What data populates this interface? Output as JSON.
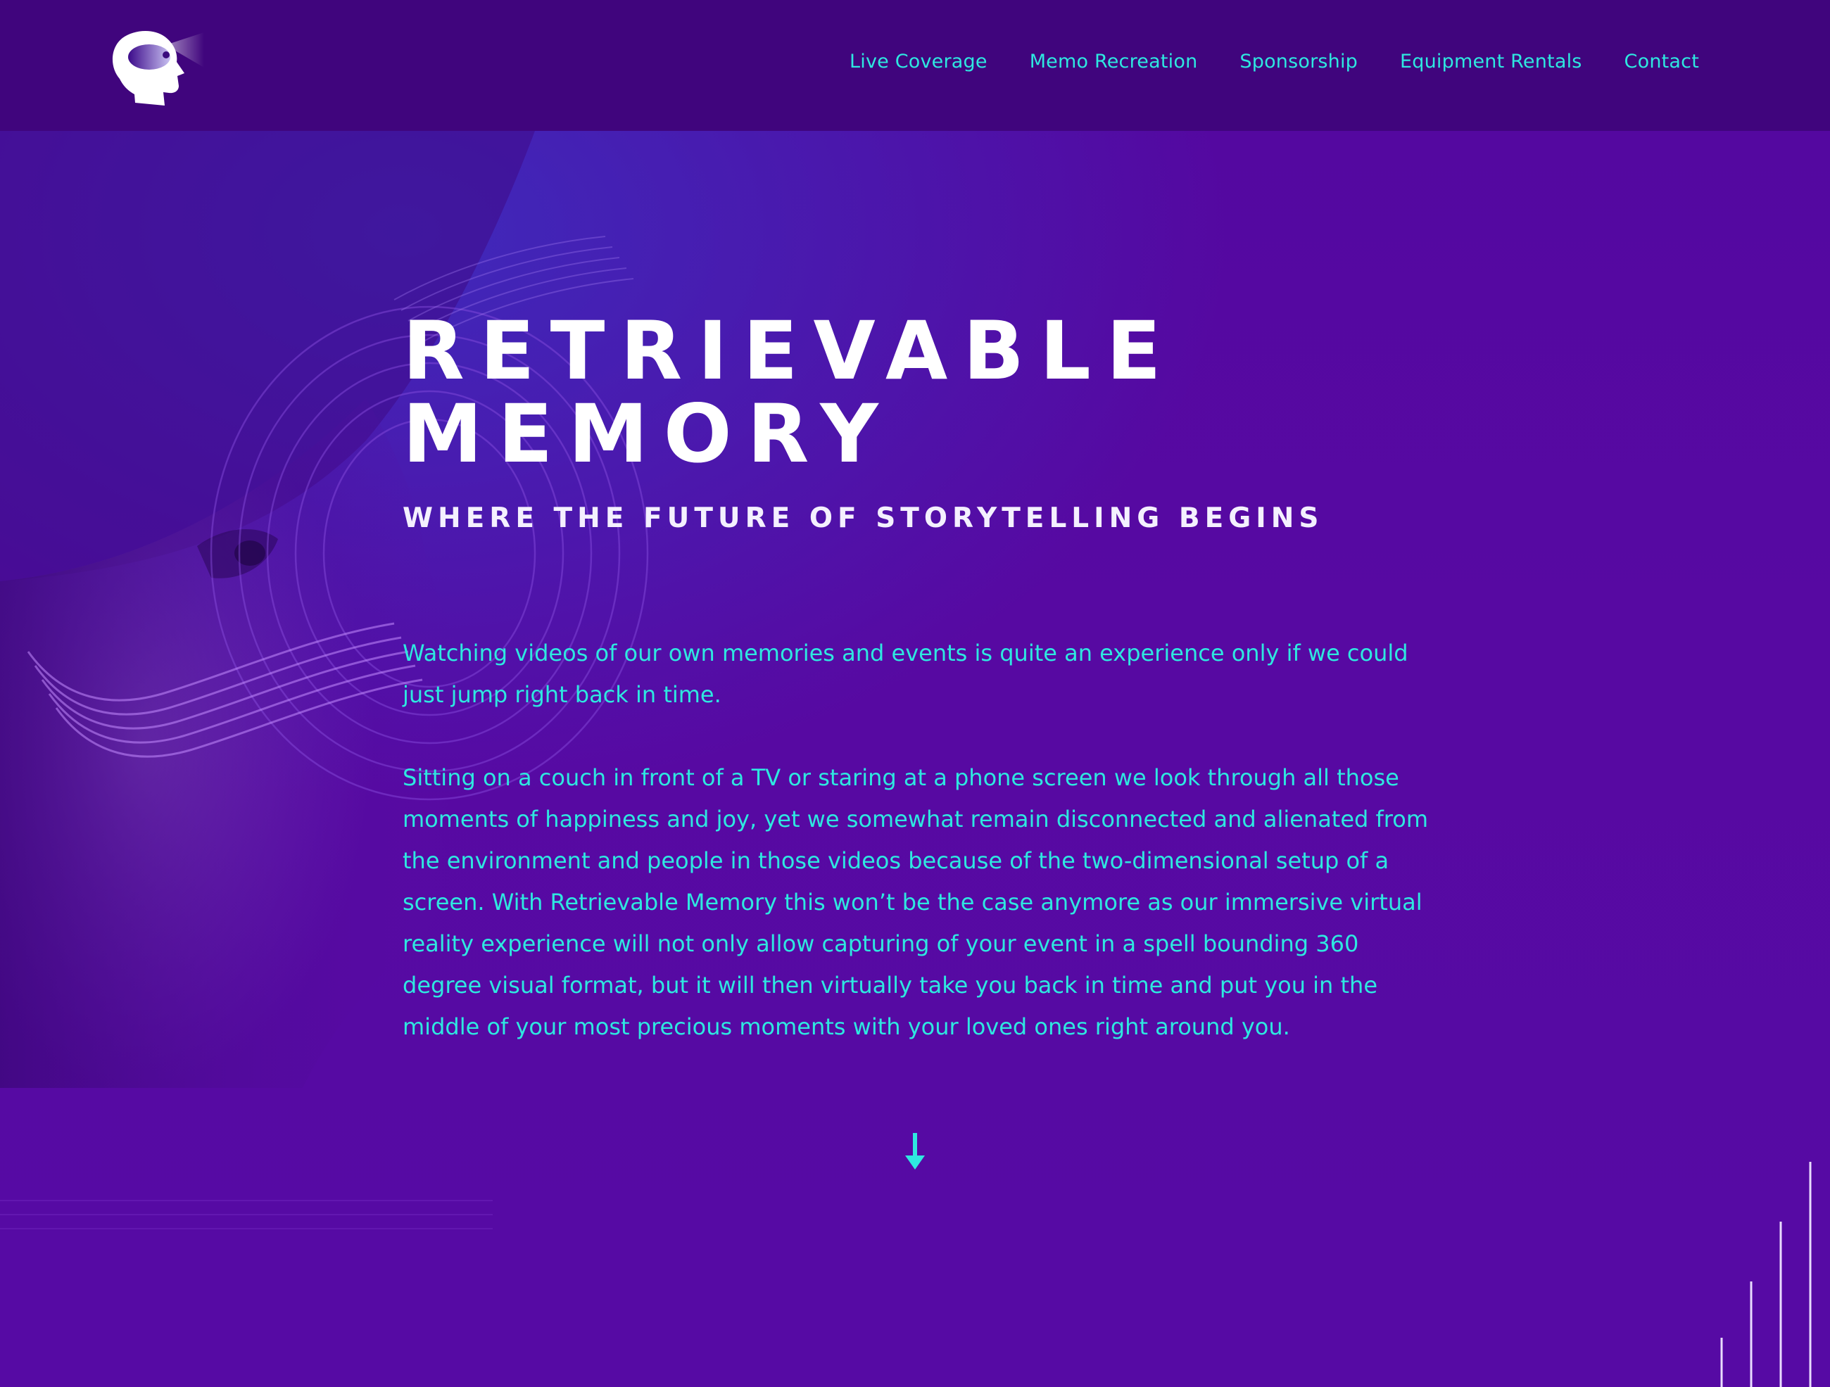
{
  "brand": {
    "logo_icon": "head-vr-logo-icon",
    "accent_color": "#2ee8e0",
    "header_bg": "#40057d",
    "page_bg": "#560aa3"
  },
  "nav": {
    "items": [
      {
        "label": "Live Coverage"
      },
      {
        "label": "Memo Recreation"
      },
      {
        "label": "Sponsorship"
      },
      {
        "label": "Equipment Rentals"
      },
      {
        "label": "Contact"
      }
    ]
  },
  "hero": {
    "title_line1": "RETRIEVABLE",
    "title_line2": "MEMORY",
    "subtitle": "WHERE THE FUTURE OF STORYTELLING BEGINS",
    "paragraphs": [
      "Watching videos of our own memories and events is quite an experience only if we could just jump right back in time.",
      "Sitting on a couch in front of a TV or staring at a phone screen we look through all those moments of happiness and joy, yet we somewhat remain disconnected and alienated from the environment and people in those videos because of the two-dimensional setup of a screen. With Retrievable Memory this won’t be the case anymore as our immersive virtual reality experience will not only allow capturing of your event in a spell bounding 360 degree visual format, but it will then virtually take you back in time and put you in the middle of your most precious moments with your loved ones right around you."
    ],
    "scroll_icon": "arrow-down-icon"
  }
}
